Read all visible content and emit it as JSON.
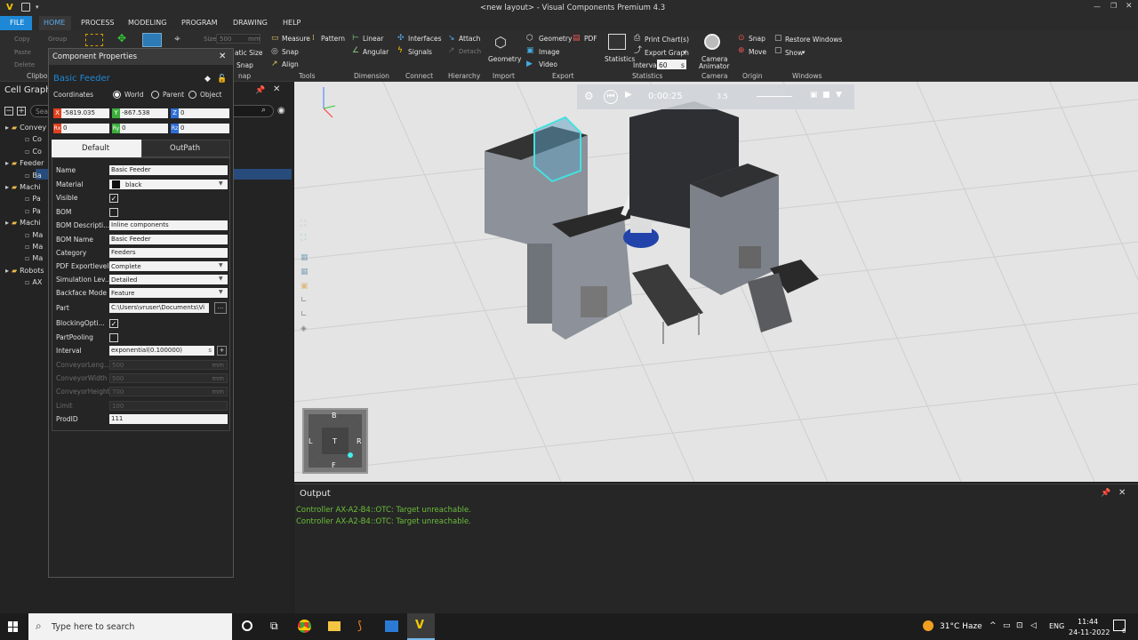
{
  "window": {
    "title": "<new layout> - Visual Components Premium 4.3"
  },
  "tabs": [
    "FILE",
    "HOME",
    "PROCESS",
    "MODELING",
    "PROGRAM",
    "DRAWING",
    "HELP"
  ],
  "ribbon": {
    "clipboard": {
      "copy": "Copy",
      "paste": "Paste",
      "delete": "Delete",
      "group": "Group",
      "label": "Clipbo"
    },
    "grid": {
      "size_label": "Size",
      "size_value": "500",
      "size_unit": "mm",
      "static_size": "atic Size",
      "snap": "Snap",
      "label": "nap"
    },
    "tools": {
      "measure": "Measure",
      "pattern": "Pattern",
      "snap": "Snap",
      "align": "Align",
      "label": "Tools"
    },
    "dimension": {
      "linear": "Linear",
      "angular": "Angular",
      "label": "Dimension"
    },
    "connect": {
      "interfaces": "Interfaces",
      "signals": "Signals",
      "label": "Connect"
    },
    "hierarchy": {
      "attach": "Attach",
      "detach": "Detach",
      "label": "Hierarchy"
    },
    "import": {
      "geometry": "Geometry",
      "label": "Import"
    },
    "export": {
      "geometry": "Geometry",
      "pdf": "PDF",
      "image": "Image",
      "video": "Video",
      "label": "Export"
    },
    "statistics": {
      "statistics": "Statistics",
      "print": "Print Chart(s)",
      "export_graph": "Export Graph",
      "interval_label": "Interval",
      "interval_value": "60",
      "interval_unit": "s",
      "label": "Statistics"
    },
    "camera": {
      "animator": "Camera Animator",
      "label": "Camera"
    },
    "origin": {
      "snap": "Snap",
      "move": "Move",
      "label": "Origin"
    },
    "windows": {
      "restore": "Restore Windows",
      "show": "Show",
      "label": "Windows"
    }
  },
  "cell_graph": {
    "title": "Cell Graph",
    "search_placeholder": "Sea",
    "items": [
      {
        "label": "Convey",
        "level": 0,
        "type": "folder"
      },
      {
        "label": "Co",
        "level": 1,
        "type": "item"
      },
      {
        "label": "Co",
        "level": 1,
        "type": "item"
      },
      {
        "label": "Feeder",
        "level": 0,
        "type": "folder"
      },
      {
        "label": "Ba",
        "level": 1,
        "type": "item",
        "selected": true
      },
      {
        "label": "Machi",
        "level": 0,
        "type": "folder"
      },
      {
        "label": "Pa",
        "level": 1,
        "type": "item"
      },
      {
        "label": "Pa",
        "level": 1,
        "type": "item"
      },
      {
        "label": "Machi",
        "level": 0,
        "type": "folder"
      },
      {
        "label": "Ma",
        "level": 1,
        "type": "item"
      },
      {
        "label": "Ma",
        "level": 1,
        "type": "item"
      },
      {
        "label": "Ma",
        "level": 1,
        "type": "item"
      },
      {
        "label": "Robots",
        "level": 0,
        "type": "folder"
      },
      {
        "label": "AX",
        "level": 1,
        "type": "item"
      }
    ]
  },
  "component_properties": {
    "title": "Component Properties",
    "component_name": "Basic Feeder",
    "coordinates": {
      "label": "Coordinates",
      "options": [
        "World",
        "Parent",
        "Object"
      ],
      "selected": "World"
    },
    "position": {
      "x": "-5819.035",
      "y": "-867.538",
      "z": "0",
      "rx": "0",
      "ry": "0",
      "rz": "0"
    },
    "axis_labels": {
      "x": "X",
      "y": "Y",
      "z": "Z",
      "rx": "Rx",
      "ry": "Ry",
      "rz": "Rz"
    },
    "tabs": [
      "Default",
      "OutPath"
    ],
    "active_tab": "Default",
    "fields": {
      "name": {
        "label": "Name",
        "value": "Basic Feeder"
      },
      "material": {
        "label": "Material",
        "value": "black"
      },
      "visible": {
        "label": "Visible",
        "checked": true
      },
      "bom": {
        "label": "BOM",
        "checked": false
      },
      "bom_description": {
        "label": "BOM Descripti...",
        "value": "Inline components"
      },
      "bom_name": {
        "label": "BOM Name",
        "value": "Basic Feeder"
      },
      "category": {
        "label": "Category",
        "value": "Feeders"
      },
      "pdf_export": {
        "label": "PDF Exportlevel",
        "value": "Complete"
      },
      "simulation": {
        "label": "Simulation Lev...",
        "value": "Detailed"
      },
      "backface": {
        "label": "Backface Mode",
        "value": "Feature"
      },
      "part": {
        "label": "Part",
        "value": "C:\\Users\\vruser\\Documents\\Vi",
        "browse": "..."
      },
      "blocking": {
        "label": "BlockingOpti...",
        "checked": true
      },
      "pooling": {
        "label": "PartPooling",
        "checked": false
      },
      "interval": {
        "label": "Interval",
        "value": "exponential(0.100000)",
        "unit": "s",
        "plus": "+"
      },
      "conveyor_length": {
        "label": "ConveyorLeng...",
        "value": "500",
        "unit": "mm"
      },
      "conveyor_width": {
        "label": "ConveyorWidth",
        "value": "500",
        "unit": "mm"
      },
      "conveyor_height": {
        "label": "ConveyorHeight",
        "value": "700",
        "unit": "mm"
      },
      "limit": {
        "label": "Limit",
        "value": "100"
      },
      "prodid": {
        "label": "ProdID",
        "value": "111"
      }
    }
  },
  "viewport": {
    "playback_time": "0:00:25",
    "speed": "3.5",
    "navcube": {
      "top": "B",
      "left": "L",
      "center": "T",
      "right": "R",
      "bottom": "F"
    }
  },
  "output": {
    "title": "Output",
    "lines": [
      "Controller AX-A2-B4::OTC: Target unreachable.",
      "Controller AX-A2-B4::OTC: Target unreachable."
    ]
  },
  "taskbar": {
    "search_placeholder": "Type here to search",
    "weather": "31°C  Haze",
    "language": "ENG",
    "time": "11:44",
    "date": "24-11-2022",
    "notification_count": "6"
  },
  "colors": {
    "accent": "#1e88d6",
    "output_text": "#6bbf3a",
    "selection": "#2a5d9f",
    "ribbon_bg": "#2d2d2d"
  }
}
